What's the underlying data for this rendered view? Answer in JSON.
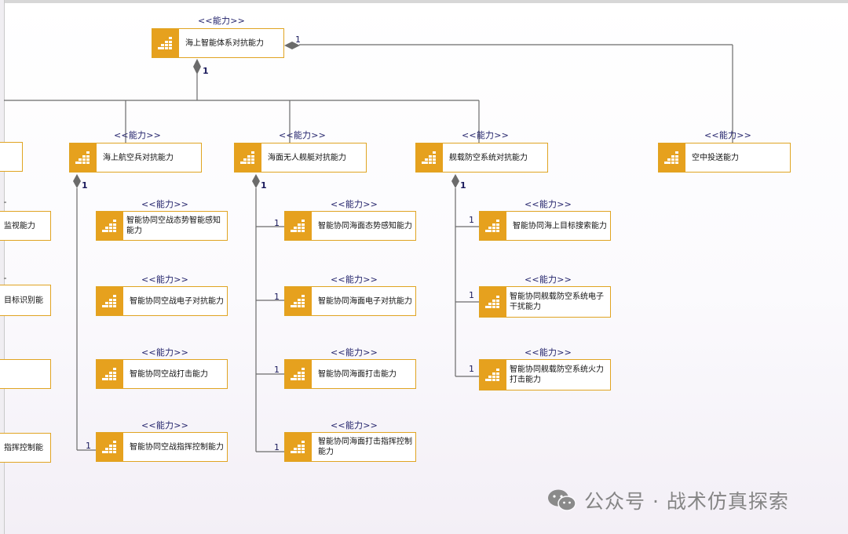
{
  "stereotype": "<<能力>>",
  "colors": {
    "accent": "#e6a11e",
    "line": "#6b6b6b",
    "text": "#111111"
  },
  "icon": "capability-staircase-icon",
  "root": {
    "label": "海上智能体系对抗能力"
  },
  "children": [
    {
      "label": "海上航空兵对抗能力"
    },
    {
      "label": "海面无人舰艇对抗能力"
    },
    {
      "label": "舰载防空系统对抗能力"
    },
    {
      "label": "空中投送能力"
    }
  ],
  "col1": [
    "智能协同空战态势智能感知能力",
    "智能协同空战电子对抗能力",
    "智能协同空战打击能力",
    "智能协同空战指挥控制能力"
  ],
  "col2": [
    "智能协同海面态势感知能力",
    "智能协同海面电子对抗能力",
    "智能协同海面打击能力",
    "智能协同海面打击指挥控制能力"
  ],
  "col3": [
    "智能协同海上目标搜索能力",
    "智能协同舰载防空系统电子干扰能力",
    "智能协同舰载防空系统火力打击能力"
  ],
  "left_partial": [
    "监视能力",
    "目标识别能",
    "指挥控制能"
  ],
  "multiplicity": "1",
  "watermark": "公众号 · 战术仿真探索"
}
